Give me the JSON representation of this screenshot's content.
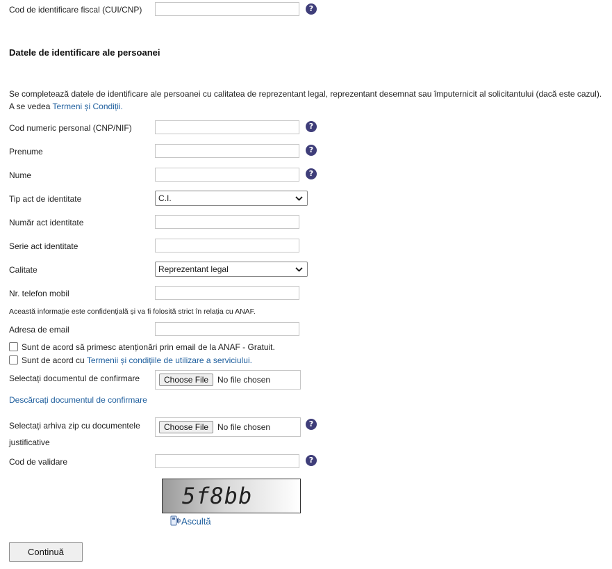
{
  "fields": {
    "fiscal_code_label": "Cod de identificare fiscal (CUI/CNP)",
    "cnp_label": "Cod numeric personal (CNP/NIF)",
    "first_name_label": "Prenume",
    "last_name_label": "Nume",
    "id_type_label": "Tip act de identitate",
    "id_type_value": "C.I.",
    "id_number_label": "Număr act identitate",
    "id_series_label": "Serie act identitate",
    "capacity_label": "Calitate",
    "capacity_value": "Reprezentant legal",
    "phone_label": "Nr. telefon mobil",
    "phone_note": "Această informație este confidențială și va fi folosită strict în relația cu ANAF.",
    "email_label": "Adresa de email",
    "confirm_doc_label": "Selectați documentul de confirmare",
    "download_confirm_link": "Descărcați documentul de confirmare",
    "zip_label_line1": "Selectați arhiva zip cu documentele",
    "zip_label_line2": "justificative",
    "validation_code_label": "Cod de validare"
  },
  "section": {
    "title": "Datele de identificare ale persoanei",
    "intro_line1": "Se completează datele de identificare ale persoanei cu calitatea de reprezentant legal, reprezentant desemnat sau împuternicit al solicitantului (dacă este cazul).",
    "intro_prefix": "A se vedea ",
    "terms_link": "Termeni și Condiții."
  },
  "checkboxes": {
    "email_alerts": "Sunt de acord să primesc atenționări prin email de la ANAF - Gratuit.",
    "agree_prefix": "Sunt de acord cu ",
    "agree_link": "Termenii și condițiile de utilizare a serviciului."
  },
  "file_input": {
    "button_label": "Choose File",
    "status": "No file chosen"
  },
  "help_glyph": "?",
  "captcha": {
    "text": "5f8bb",
    "listen_label": "Ascultă"
  },
  "submit_label": "Continuă",
  "colors": {
    "help_icon": "#3f3e7a",
    "link": "#1f5f9e"
  }
}
